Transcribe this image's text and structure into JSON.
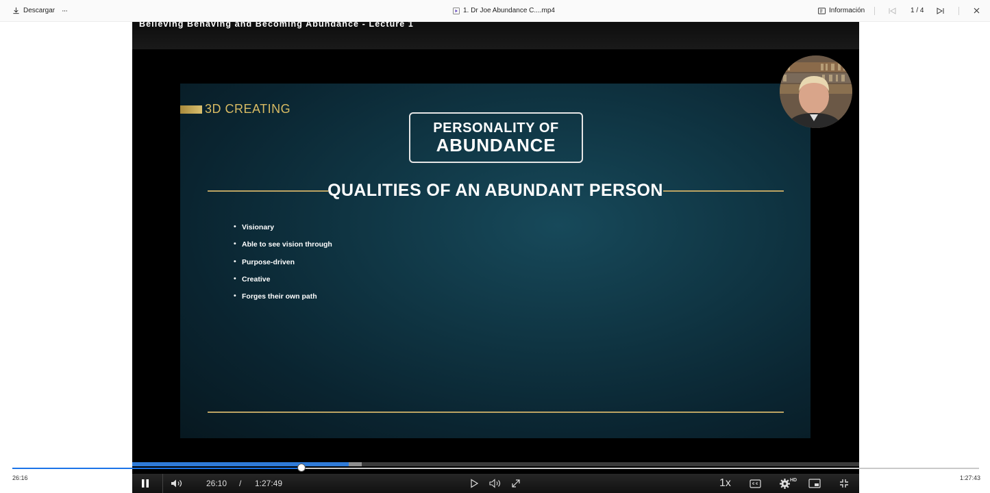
{
  "toolbar": {
    "download_label": "Descargar",
    "more_label": "···",
    "file_name": "1. Dr Joe Abundance C....mp4",
    "info_label": "Información",
    "counter": "1 / 4"
  },
  "video": {
    "title": "Believing Behaving and Becoming Abundance - Lecture 1",
    "slide": {
      "brand": "3D CREATING",
      "box_line1": "PERSONALITY OF",
      "box_line2": "ABUNDANCE",
      "heading": "QUALITIES OF AN ABUNDANT PERSON",
      "bullets": [
        "Visionary",
        "Able to see vision through",
        "Purpose-driven",
        "Creative",
        "Forges their own path"
      ]
    },
    "controls": {
      "current_time": "26:10",
      "separator": "/",
      "duration": "1:27:49",
      "speed": "1x",
      "quality_badge": "HD"
    },
    "progress_fraction": 0.298
  },
  "player": {
    "current_time": "26:16",
    "duration": "1:27:43",
    "progress_fraction": 0.299
  },
  "colors": {
    "accent": "#1a73e8",
    "slide_gold": "#d9bb63"
  }
}
